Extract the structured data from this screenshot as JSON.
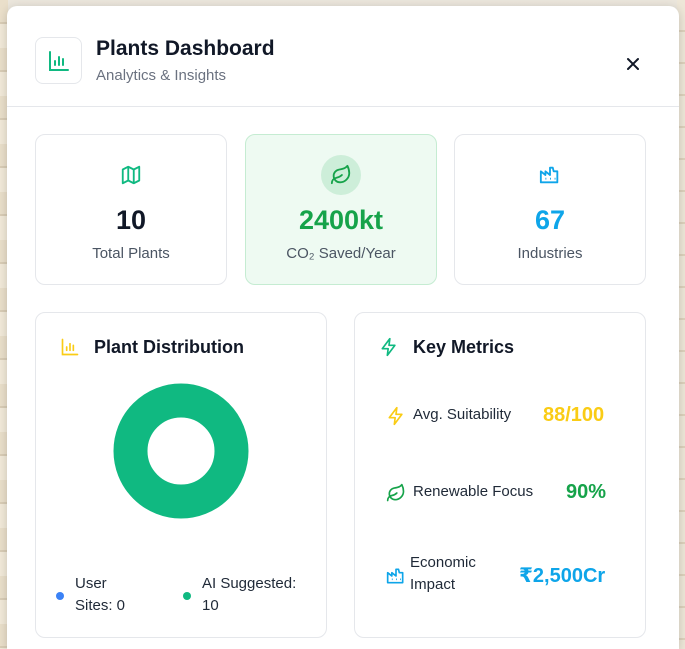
{
  "header": {
    "title": "Plants Dashboard",
    "subtitle": "Analytics & Insights",
    "logo_icon": "bar-chart-icon",
    "close_icon": "close-icon"
  },
  "stats": [
    {
      "value": "10",
      "label": "Total Plants",
      "icon": "map-icon",
      "color": "#111827"
    },
    {
      "value": "2400kt",
      "label": "CO₂ Saved/Year",
      "icon": "leaf-icon",
      "color": "#16a34a"
    },
    {
      "value": "67",
      "label": "Industries",
      "icon": "factory-icon",
      "color": "#0ea5e9"
    }
  ],
  "distribution": {
    "title": "Plant Distribution",
    "icon": "bar-chart-icon",
    "legend": [
      {
        "label": "User Sites: 0",
        "line1": "User",
        "line2": "Sites: 0",
        "color": "#3b82f6"
      },
      {
        "label": "AI Suggested: 10",
        "line1": "AI Suggested:",
        "line2": "10",
        "color": "#10b981"
      }
    ]
  },
  "chart_data": {
    "type": "pie",
    "categories": [
      "User Sites",
      "AI Suggested"
    ],
    "values": [
      0,
      10
    ],
    "colors": [
      "#3b82f6",
      "#10b981"
    ]
  },
  "metrics": {
    "title": "Key Metrics",
    "icon": "lightning-icon",
    "items": [
      {
        "label": "Avg. Suitability",
        "value": "88/100",
        "icon": "lightning-icon",
        "color": "#facc15"
      },
      {
        "label": "Renewable Focus",
        "value": "90%",
        "icon": "leaf-icon",
        "color": "#16a34a"
      },
      {
        "label_line1": "Economic",
        "label_line2": "Impact",
        "value": "₹2,500Cr",
        "icon": "factory-icon",
        "color": "#0ea5e9"
      }
    ]
  },
  "colors": {
    "accent_green": "#10b981",
    "accent_blue": "#0ea5e9",
    "accent_yellow": "#facc15"
  }
}
